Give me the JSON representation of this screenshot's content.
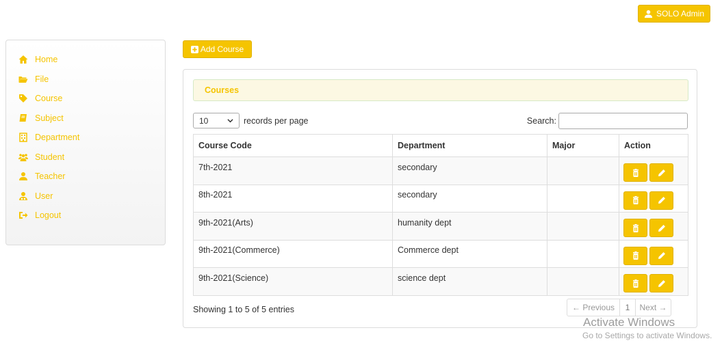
{
  "header": {
    "user_label": "SOLO Admin"
  },
  "sidebar": {
    "items": [
      {
        "label": "Home"
      },
      {
        "label": "File"
      },
      {
        "label": "Course"
      },
      {
        "label": "Subject"
      },
      {
        "label": "Department"
      },
      {
        "label": "Student"
      },
      {
        "label": "Teacher"
      },
      {
        "label": "User"
      },
      {
        "label": "Logout"
      }
    ]
  },
  "toolbar": {
    "add_label": "Add Course"
  },
  "panel": {
    "title": "Courses",
    "length": {
      "value": "10",
      "suffix": "records per page"
    },
    "search": {
      "label": "Search:",
      "value": ""
    },
    "columns": [
      "Course Code",
      "Department",
      "Major",
      "Action"
    ],
    "rows": [
      {
        "code": "7th-2021",
        "department": "secondary",
        "major": ""
      },
      {
        "code": "8th-2021",
        "department": "secondary",
        "major": ""
      },
      {
        "code": "9th-2021(Arts)",
        "department": "humanity dept",
        "major": ""
      },
      {
        "code": "9th-2021(Commerce)",
        "department": "Commerce dept",
        "major": ""
      },
      {
        "code": "9th-2021(Science)",
        "department": "science dept",
        "major": ""
      }
    ],
    "info": "Showing 1 to 5 of 5 entries",
    "pagination": {
      "previous": "← Previous",
      "page": "1",
      "next": "Next →"
    }
  },
  "watermark": {
    "line1": "Activate Windows",
    "line2": "Go to Settings to activate Windows."
  },
  "colors": {
    "accent": "#f5c400",
    "heading_bg": "#fcf8e3"
  }
}
